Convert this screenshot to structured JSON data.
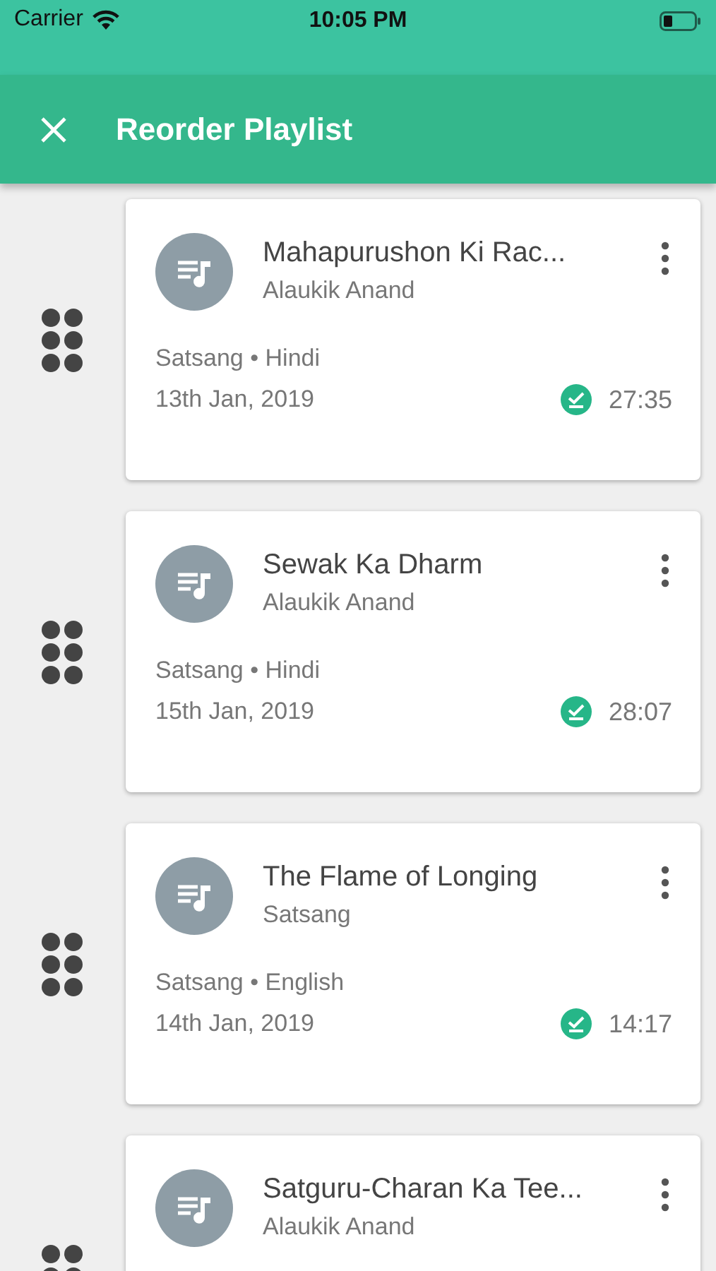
{
  "status_bar": {
    "carrier": "Carrier",
    "time": "10:05 PM"
  },
  "app_bar": {
    "title": "Reorder Playlist"
  },
  "items": [
    {
      "title": "Mahapurushon Ki Rac...",
      "subtitle": "Alaukik Anand",
      "category": "Satsang",
      "separator": "•",
      "language": "Hindi",
      "date": "13th Jan, 2019",
      "downloaded": true,
      "duration": "27:35"
    },
    {
      "title": "Sewak Ka Dharm",
      "subtitle": "Alaukik Anand",
      "category": "Satsang",
      "separator": "•",
      "language": "Hindi",
      "date": "15th Jan, 2019",
      "downloaded": true,
      "duration": "28:07"
    },
    {
      "title": "The Flame of Longing",
      "subtitle": "Satsang",
      "category": "Satsang",
      "separator": "•",
      "language": "English",
      "date": "14th Jan, 2019",
      "downloaded": true,
      "duration": "14:17"
    },
    {
      "title": "Satguru-Charan Ka Tee...",
      "subtitle": "Alaukik Anand"
    }
  ]
}
